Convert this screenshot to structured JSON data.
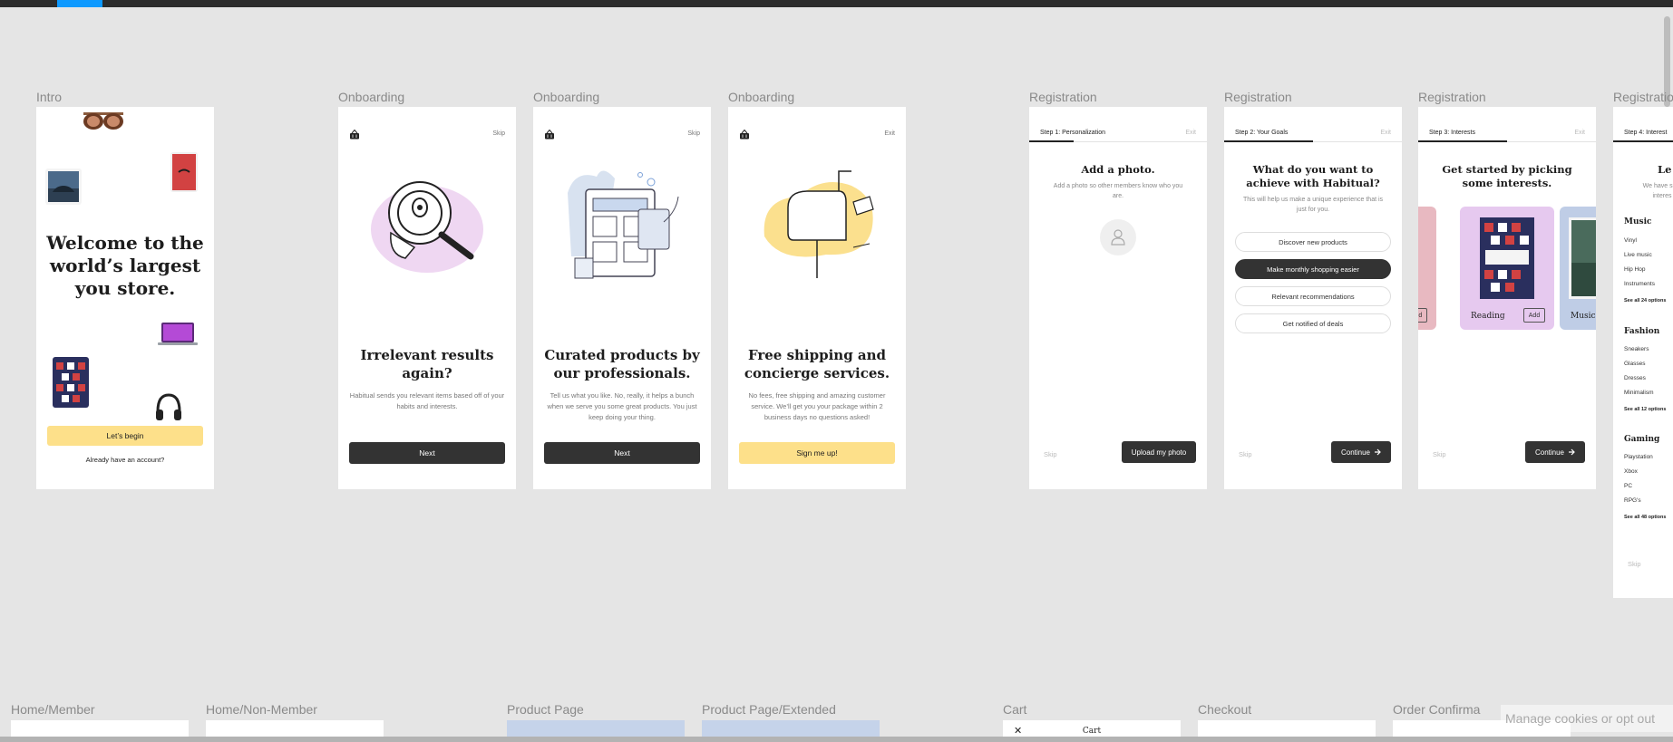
{
  "frames": {
    "intro": {
      "label": "Intro",
      "title": "Welcome to the world’s largest you store.",
      "cta": "Let’s begin",
      "login_link": "Already have an account?"
    },
    "onboarding": [
      {
        "label": "Onboarding",
        "skip": "Skip",
        "title": "Irrelevant results again?",
        "body": "Habitual sends you relevant items based off of your habits and interests.",
        "button": "Next"
      },
      {
        "label": "Onboarding",
        "skip": "Skip",
        "title": "Curated products by our professionals.",
        "body": "Tell us what you like. No, really, it helps a bunch when we serve you some great products. You just keep doing your thing.",
        "button": "Next"
      },
      {
        "label": "Onboarding",
        "skip": "Exit",
        "title": "Free shipping and concierge services.",
        "body": "No fees, free shipping and amazing customer service. We’ll get you your package within 2 business days no questions asked!",
        "button": "Sign me up!"
      }
    ],
    "registration": [
      {
        "label": "Registration",
        "step": "Step 1: Personalization",
        "exit": "Exit",
        "title": "Add a photo.",
        "subtitle": "Add a photo so other members know who you are.",
        "skip": "Skip",
        "button": "Upload my photo"
      },
      {
        "label": "Registration",
        "step": "Step 2: Your Goals",
        "exit": "Exit",
        "title": "What do you want to achieve with Habitual?",
        "subtitle": "This will help us make a unique experience that is just for you.",
        "skip": "Skip",
        "button": "Continue",
        "options": [
          "Discover new products",
          "Make monthly shopping easier",
          "Relevant recommendations",
          "Get notified of deals"
        ],
        "selected_option": "Make monthly shopping easier"
      },
      {
        "label": "Registration",
        "step": "Step 3: Interests",
        "exit": "Exit",
        "title": "Get started by picking some interests.",
        "skip": "Skip",
        "button": "Continue",
        "cards": [
          {
            "name": "",
            "add": "Add"
          },
          {
            "name": "Reading",
            "add": "Add"
          },
          {
            "name": "Music",
            "add": ""
          }
        ]
      },
      {
        "label": "Registration",
        "step": "Step 4: Interest",
        "title": "Le",
        "subtitle": "We have som interes",
        "skip": "Skip",
        "categories": [
          {
            "name": "Music",
            "items": [
              "Vinyl",
              "Live music",
              "Hip Hop",
              "Instruments"
            ],
            "see_all": "See all 24 options"
          },
          {
            "name": "Fashion",
            "items": [
              "Sneakers",
              "Glasses",
              "Dresses",
              "Minimalism"
            ],
            "see_all": "See all 12 options"
          },
          {
            "name": "Gaming",
            "items": [
              "Playstation",
              "Xbox",
              "PC",
              "RPG's"
            ],
            "see_all": "See all 48 options"
          }
        ]
      }
    ],
    "bottom_row": [
      "Home/Member",
      "Home/Non-Member",
      "Product Page",
      "Product Page/Extended",
      "Cart",
      "Checkout",
      "Order Confirma"
    ],
    "cart_title": "Cart"
  },
  "cookies": "Manage cookies or opt out",
  "colors": {
    "canvas": "#e5e5e5",
    "accent_yellow": "#fde08a",
    "dark_button": "#333333",
    "active_tab": "#0d99ff"
  },
  "icons": [
    "shopping-basket-icon",
    "user-placeholder-icon",
    "arrow-right-icon",
    "close-icon"
  ]
}
